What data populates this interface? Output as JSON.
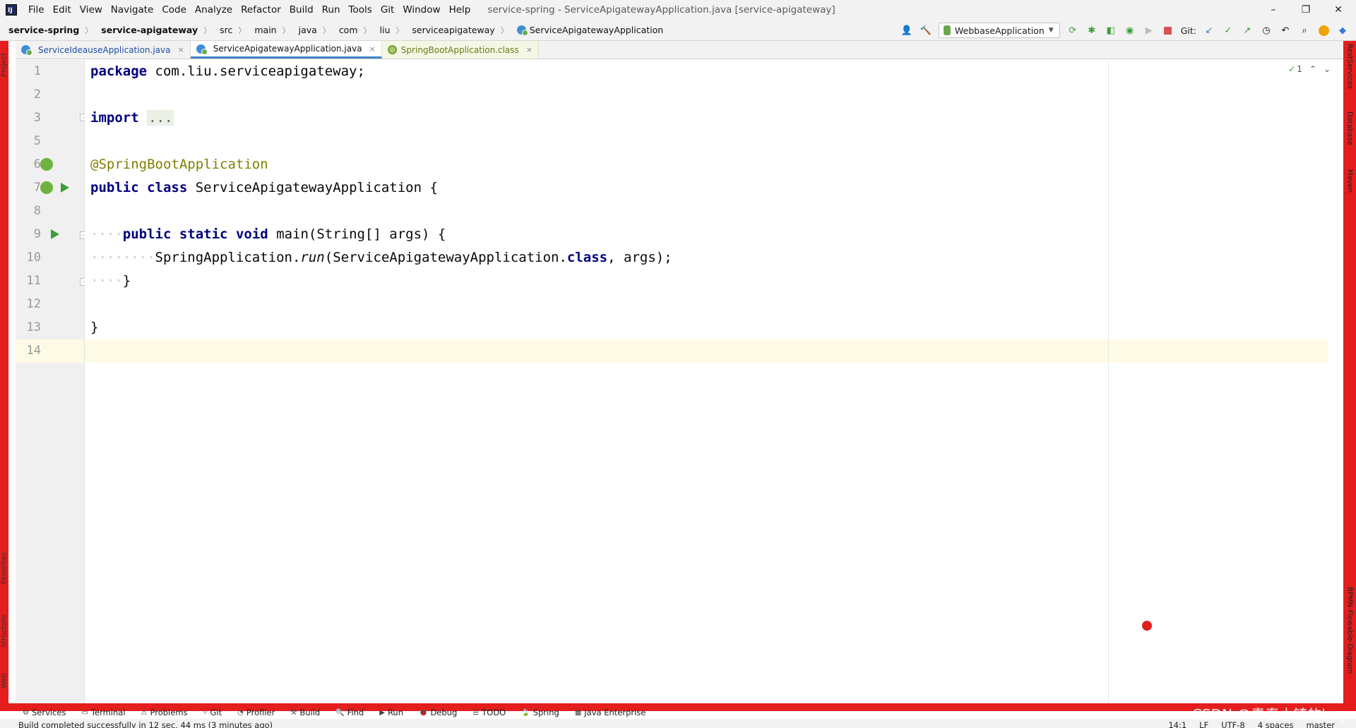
{
  "app": {
    "window_title": "service-spring - ServiceApigatewayApplication.java [service-apigateway]",
    "logo": "IJ"
  },
  "menu": [
    {
      "label": "File"
    },
    {
      "label": "Edit"
    },
    {
      "label": "View"
    },
    {
      "label": "Navigate"
    },
    {
      "label": "Code"
    },
    {
      "label": "Analyze"
    },
    {
      "label": "Refactor"
    },
    {
      "label": "Build"
    },
    {
      "label": "Run"
    },
    {
      "label": "Tools"
    },
    {
      "label": "Git"
    },
    {
      "label": "Window"
    },
    {
      "label": "Help"
    }
  ],
  "window_controls": {
    "minimize": "–",
    "restore": "❐",
    "close": "✕"
  },
  "breadcrumb": [
    {
      "label": "service-spring"
    },
    {
      "label": "service-apigateway"
    },
    {
      "label": "src"
    },
    {
      "label": "main"
    },
    {
      "label": "java"
    },
    {
      "label": "com"
    },
    {
      "label": "liu"
    },
    {
      "label": "serviceapigateway"
    },
    {
      "label": "ServiceApigatewayApplication"
    }
  ],
  "toolbar": {
    "run_config": "WebbaseApplication",
    "git_label": "Git:"
  },
  "tabs": [
    {
      "label": "ServiceIdeauseApplication.java",
      "close": "×"
    },
    {
      "label": "ServiceApigatewayApplication.java",
      "close": "×"
    },
    {
      "label": "SpringBootApplication.class",
      "close": "×"
    }
  ],
  "editor": {
    "inspection_count": "1",
    "lines": [
      {
        "num": "1"
      },
      {
        "num": "2"
      },
      {
        "num": "3"
      },
      {
        "num": "5"
      },
      {
        "num": "6"
      },
      {
        "num": "7"
      },
      {
        "num": "8"
      },
      {
        "num": "9"
      },
      {
        "num": "10"
      },
      {
        "num": "11"
      },
      {
        "num": "12"
      },
      {
        "num": "13"
      },
      {
        "num": "14"
      }
    ],
    "code": {
      "l1_kw": "package",
      "l1_rest": " com.liu.serviceapigateway;",
      "l3_kw": "import",
      "l3_fold": "...",
      "l6_ann": "@SpringBootApplication",
      "l7_kw1": "public",
      "l7_kw2": "class",
      "l7_rest": " ServiceApigatewayApplication {",
      "l9_kw1": "public",
      "l9_kw2": "static",
      "l9_kw3": "void",
      "l9_rest": " main(String[] args) {",
      "l10_a": "SpringApplication.",
      "l10_run": "run",
      "l10_b": "(ServiceApigatewayApplication.",
      "l10_kw": "class",
      "l10_c": ", args);",
      "l11": "}",
      "l13": "}"
    }
  },
  "left_tool_tabs": {
    "project": "Project",
    "favorites": "Favorites",
    "structure": "Structure",
    "web": "Web"
  },
  "right_tool_tabs": {
    "rest": "RestServices",
    "database": "Database",
    "maven": "Maven",
    "bpmn": "BPMN-Flowable-Diagram"
  },
  "bottom_tools": [
    {
      "icon": "⚙",
      "label": "Services"
    },
    {
      "icon": "▭",
      "label": "Terminal"
    },
    {
      "icon": "⚠",
      "label": "Problems"
    },
    {
      "icon": "⑂",
      "label": "Git"
    },
    {
      "icon": "◔",
      "label": "Profiler"
    },
    {
      "icon": "⚒",
      "label": "Build"
    },
    {
      "icon": "🔍",
      "label": "Find"
    },
    {
      "icon": "▶",
      "label": "Run"
    },
    {
      "icon": "🐞",
      "label": "Debug"
    },
    {
      "icon": "☰",
      "label": "TODO"
    },
    {
      "icon": "🍃",
      "label": "Spring"
    },
    {
      "icon": "▦",
      "label": "Java Enterprise"
    }
  ],
  "status": {
    "message": "Build completed successfully in 12 sec, 44 ms (3 minutes ago)",
    "position": "14:1",
    "line_sep": "LF",
    "encoding": "UTF-8",
    "indent": "4 spaces",
    "branch": "master"
  },
  "watermark": "CSDN @青春小镇的boy",
  "colors": {
    "frame_red": "#e41d1d",
    "keyword": "#000080",
    "annotation": "#808000",
    "run_green": "#3d9e3a"
  }
}
